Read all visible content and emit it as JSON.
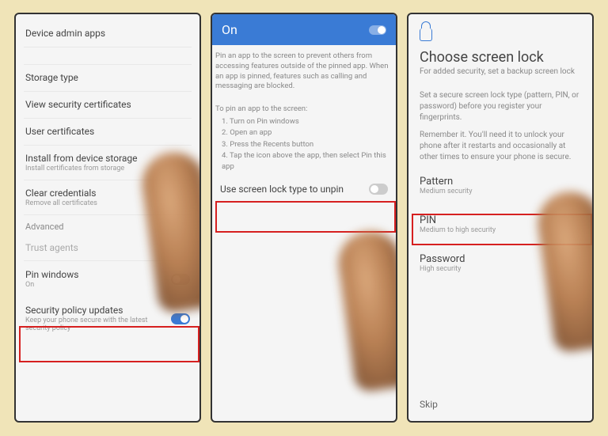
{
  "phone1": {
    "items": [
      {
        "title": "Device admin apps",
        "sub": ""
      },
      {
        "title": "",
        "sub": ""
      },
      {
        "title": "Storage type",
        "sub": ""
      },
      {
        "title": "View security certificates",
        "sub": ""
      },
      {
        "title": "User certificates",
        "sub": ""
      },
      {
        "title": "Install from device storage",
        "sub": "Install certificates from storage"
      },
      {
        "title": "Clear credentials",
        "sub": "Remove all certificates"
      }
    ],
    "section": "Advanced",
    "trust": "Trust agents",
    "pin": {
      "title": "Pin windows",
      "sub": "On"
    },
    "security": {
      "title": "Security policy updates",
      "sub": "Keep your phone secure with the latest security policy"
    }
  },
  "phone2": {
    "header": "On",
    "desc": "Pin an app to the screen to prevent others from accessing features outside of the pinned app. When an app is pinned, features such as calling and messaging are blocked.",
    "steps_hdr": "To pin an app to the screen:",
    "steps": [
      "1. Turn on Pin windows",
      "2. Open an app",
      "3. Press the Recents button",
      "4. Tap the icon above the app, then select Pin this app"
    ],
    "unpin": "Use screen lock type to unpin"
  },
  "phone3": {
    "title": "Choose screen lock",
    "subtitle": "For added security, set a backup screen lock",
    "info1": "Set a secure screen lock type (pattern, PIN, or password) before you register your fingerprints.",
    "info2": "Remember it. You'll need it to unlock your phone after it restarts and occasionally at other times to ensure your phone is secure.",
    "options": [
      {
        "title": "Pattern",
        "sub": "Medium security"
      },
      {
        "title": "PIN",
        "sub": "Medium to high security"
      },
      {
        "title": "Password",
        "sub": "High security"
      }
    ],
    "skip": "Skip"
  }
}
